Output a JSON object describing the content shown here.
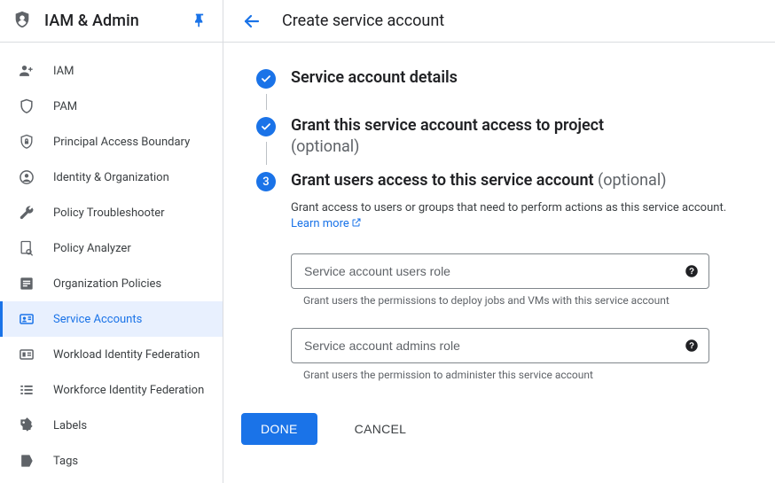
{
  "sidebar": {
    "title": "IAM & Admin",
    "items": [
      {
        "label": "IAM",
        "icon": "person-add"
      },
      {
        "label": "PAM",
        "icon": "shield"
      },
      {
        "label": "Principal Access Boundary",
        "icon": "shield-lock"
      },
      {
        "label": "Identity & Organization",
        "icon": "person-circle"
      },
      {
        "label": "Policy Troubleshooter",
        "icon": "wrench"
      },
      {
        "label": "Policy Analyzer",
        "icon": "doc-search"
      },
      {
        "label": "Organization Policies",
        "icon": "list-box"
      },
      {
        "label": "Service Accounts",
        "icon": "badge",
        "active": true
      },
      {
        "label": "Workload Identity Federation",
        "icon": "id-card"
      },
      {
        "label": "Workforce Identity Federation",
        "icon": "list-lines"
      },
      {
        "label": "Labels",
        "icon": "tag"
      },
      {
        "label": "Tags",
        "icon": "bookmark"
      }
    ]
  },
  "header": {
    "page_title": "Create service account"
  },
  "steps": {
    "s1": {
      "title": "Service account details"
    },
    "s2": {
      "title": "Grant this service account access to project",
      "optional": "(optional)"
    },
    "s3": {
      "number": "3",
      "title": "Grant users access to this service account",
      "optional": "(optional)",
      "description": "Grant access to users or groups that need to perform actions as this service account. ",
      "learn_more": "Learn more"
    }
  },
  "fields": {
    "users": {
      "placeholder": "Service account users role",
      "helper": "Grant users the permissions to deploy jobs and VMs with this service account"
    },
    "admins": {
      "placeholder": "Service account admins role",
      "helper": "Grant users the permission to administer this service account"
    }
  },
  "buttons": {
    "done": "DONE",
    "cancel": "CANCEL"
  }
}
